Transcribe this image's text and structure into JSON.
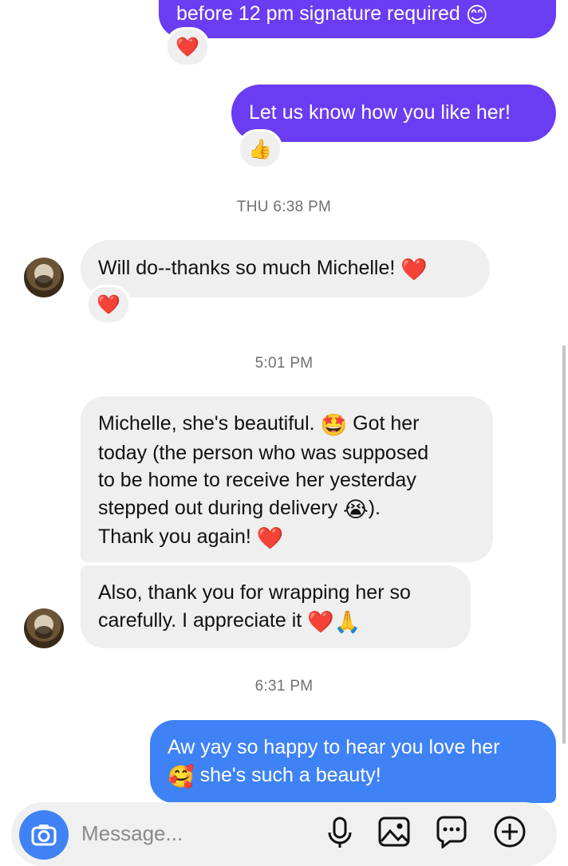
{
  "messages": {
    "m1": {
      "text": "before 12 pm signature required",
      "emoji": "😊",
      "reaction": "❤️"
    },
    "m2": {
      "text": "Let us know how you like her!",
      "reaction": "👍"
    },
    "ts1": "THU 6:38 PM",
    "m3": {
      "text": "Will do--thanks so much Michelle!",
      "emoji": "❤️",
      "reaction": "❤️"
    },
    "ts2": "5:01 PM",
    "m4": {
      "line1": "Michelle, she's beautiful.",
      "emoji1": "🤩",
      "line1b": "Got her",
      "line2": "today (the person who was supposed",
      "line3": "to be home to receive her yesterday",
      "line4": "stepped out during delivery",
      "emoji2": "😭",
      "line4b": ").",
      "line5": "Thank you again!",
      "emoji3": "❤️"
    },
    "m5": {
      "line1": "Also, thank you for wrapping her so",
      "line2": "carefully. I appreciate it",
      "emoji": "❤️🙏"
    },
    "ts3": "6:31 PM",
    "m6": {
      "line1": "Aw yay so happy to hear you love her",
      "emoji": "🥰",
      "line2": "she's such a beauty!"
    }
  },
  "composer": {
    "placeholder": "Message...",
    "icons": [
      "camera-icon",
      "microphone-icon",
      "gallery-icon",
      "sticker-icon",
      "plus-icon"
    ]
  },
  "colors": {
    "outgoing_purple": "#6a3cf2",
    "outgoing_blue": "#3f82f5",
    "incoming": "#efefef",
    "timestamp": "#707070"
  }
}
